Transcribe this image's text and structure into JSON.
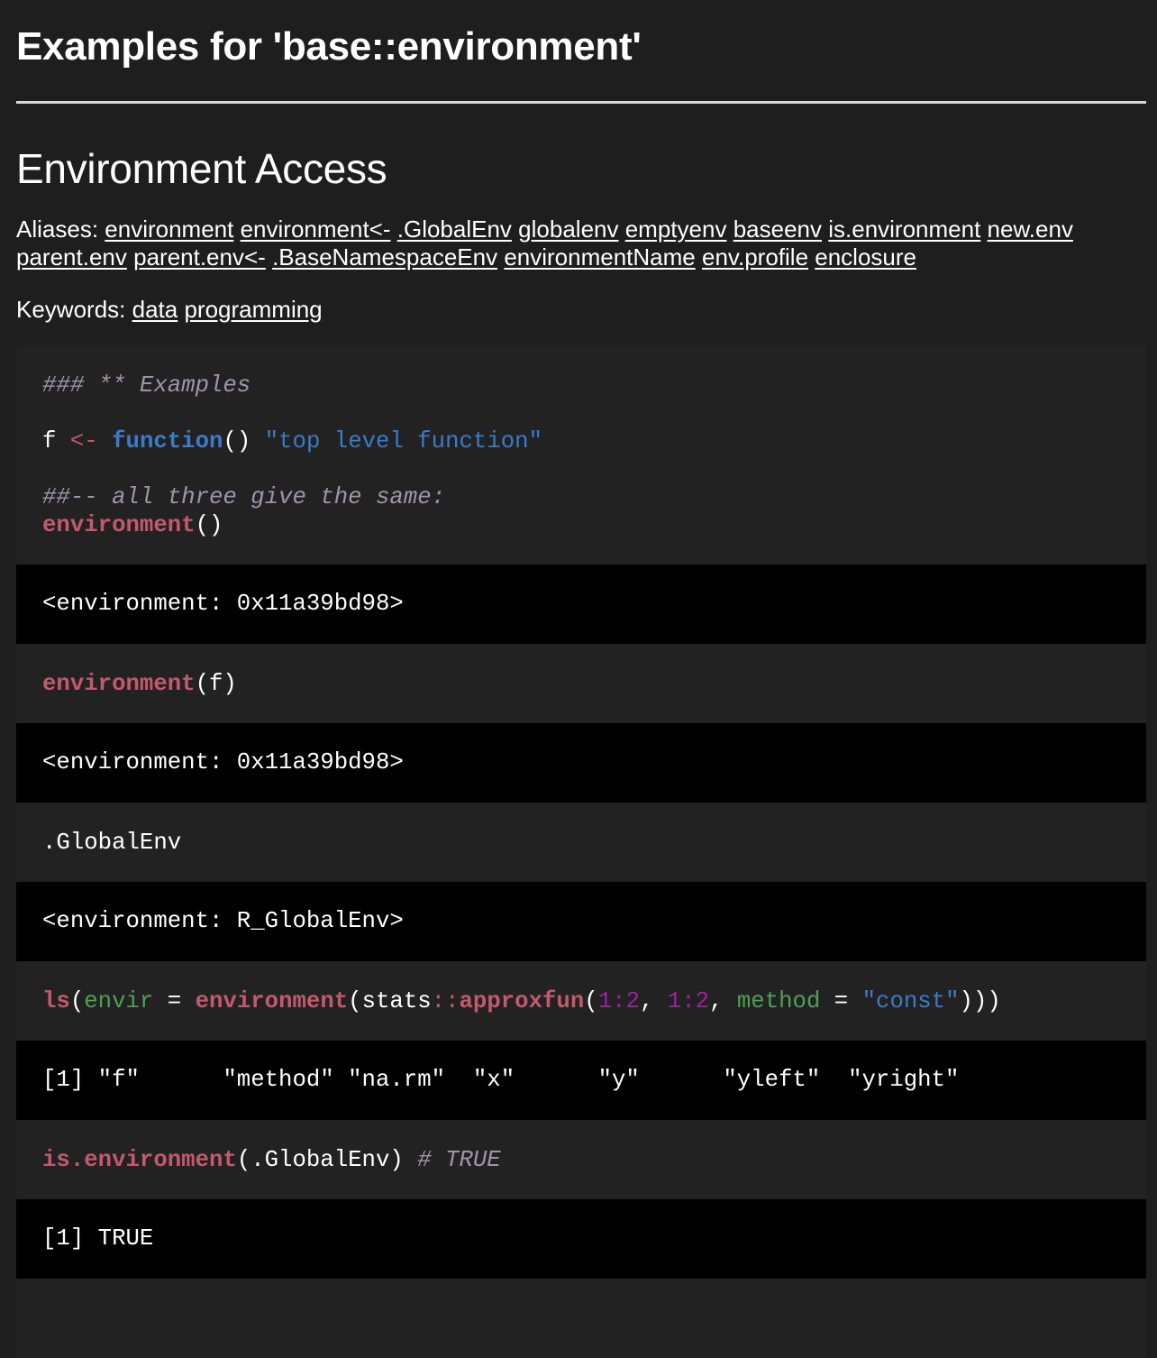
{
  "page_title": "Examples for 'base::environment'",
  "section_title": "Environment Access",
  "aliases": {
    "label": "Aliases:",
    "items": [
      "environment",
      "environment<-",
      ".GlobalEnv",
      "globalenv",
      "emptyenv",
      "baseenv",
      "is.environment",
      "new.env",
      "parent.env",
      "parent.env<-",
      ".BaseNamespaceEnv",
      "environmentName",
      "env.profile",
      "enclosure"
    ]
  },
  "keywords": {
    "label": "Keywords:",
    "items": [
      "data",
      "programming"
    ]
  },
  "code_block_1": {
    "line_1": "### ** Examples",
    "line_2_var": "f",
    "line_2_assign": "<-",
    "line_2_keyword": "function",
    "line_2_parens": "()",
    "line_2_string": "\"top level function\"",
    "line_3_comment": "##-- all three give the same:",
    "line_4_fn": "environment",
    "line_4_rest": "()"
  },
  "output_1": "<environment: 0x11a39bd98>",
  "code_block_2": {
    "fn": "environment",
    "rest": "(f)"
  },
  "output_2": "<environment: 0x11a39bd98>",
  "code_block_3": ".GlobalEnv",
  "output_3": "<environment: R_GlobalEnv>",
  "code_block_4": {
    "fn_ls": "ls",
    "paren_open": "(",
    "arg_envir": "envir",
    "eq_1": " = ",
    "fn_environment": "environment",
    "paren_open_2": "(stats",
    "ns_op": "::",
    "fn_approxfun": "approxfun",
    "paren_open_3": "(",
    "num_1": "1:2",
    "comma_1": ", ",
    "num_2": "1:2",
    "comma_2": ", ",
    "arg_method": "method",
    "eq_2": " = ",
    "str_const": "\"const\"",
    "closing": ")))"
  },
  "output_4": "[1] \"f\"      \"method\" \"na.rm\"  \"x\"      \"y\"      \"yleft\"  \"yright\"",
  "code_block_5": {
    "fn": "is.environment",
    "rest": "(.GlobalEnv) ",
    "comment": "# TRUE"
  },
  "output_5": "[1] TRUE"
}
